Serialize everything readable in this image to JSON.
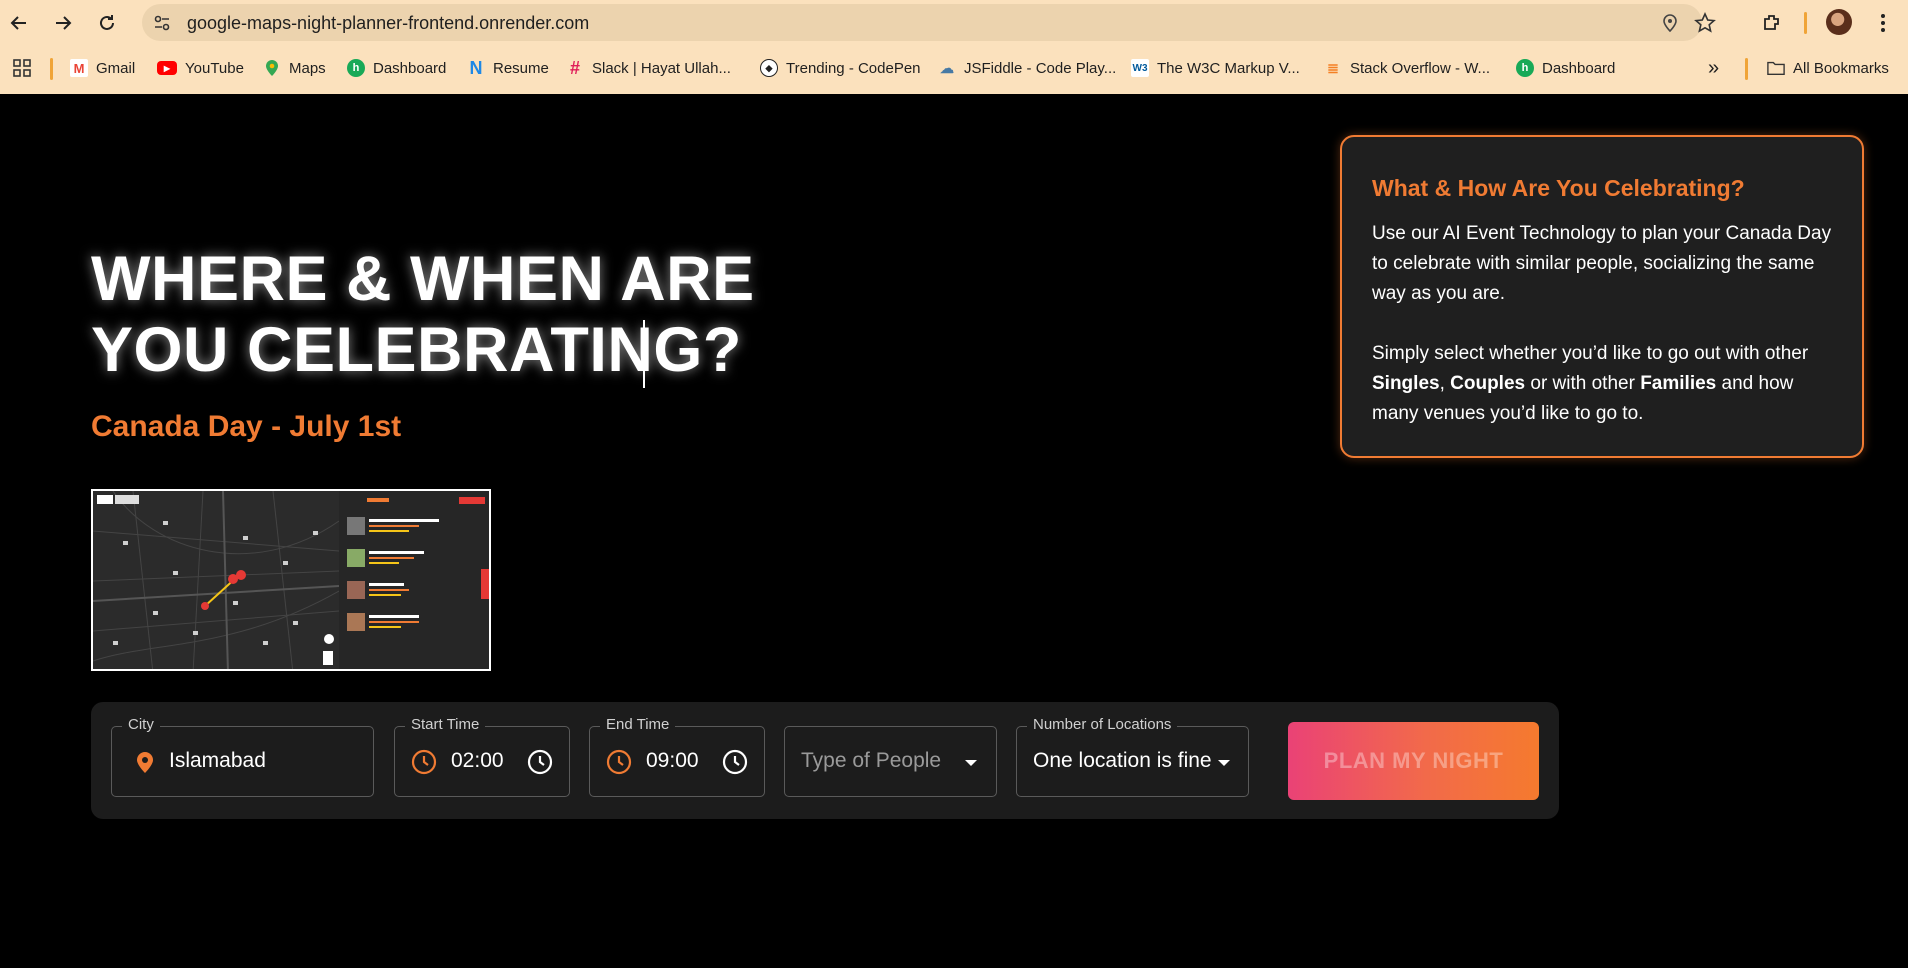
{
  "browser": {
    "url": "google-maps-night-planner-frontend.onrender.com",
    "bookmarks": [
      {
        "label": "Gmail",
        "icon": "gmail-icon"
      },
      {
        "label": "YouTube",
        "icon": "youtube-icon"
      },
      {
        "label": "Maps",
        "icon": "maps-icon"
      },
      {
        "label": "Dashboard",
        "icon": "dashboard-icon"
      },
      {
        "label": "Resume",
        "icon": "resume-icon"
      },
      {
        "label": "Slack | Hayat Ullah...",
        "icon": "slack-icon"
      },
      {
        "label": "Trending - CodePen",
        "icon": "codepen-icon"
      },
      {
        "label": "JSFiddle - Code Play...",
        "icon": "jsfiddle-icon"
      },
      {
        "label": "The W3C Markup V...",
        "icon": "w3c-icon"
      },
      {
        "label": "Stack Overflow - W...",
        "icon": "stackoverflow-icon"
      },
      {
        "label": "Dashboard",
        "icon": "dashboard-icon"
      }
    ],
    "all_bookmarks": "All Bookmarks"
  },
  "hero": {
    "title_line1": "WHERE & WHEN ARE",
    "title_line2": "YOU CELEBRATING?",
    "subtitle": "Canada Day - July 1st"
  },
  "info": {
    "title": "What & How Are You Celebrating?",
    "p1": "Use our AI Event Technology to plan your Canada Day to celebrate with similar people, socializing the same way as you are.",
    "p2_a": "Simply select whether you’d like to go out with other ",
    "singles": "Singles",
    "comma": ", ",
    "couples": "Couples",
    "p2_b": " or with other ",
    "families": "Families",
    "p2_c": " and how many venues you’d like to go to."
  },
  "form": {
    "city_label": "City",
    "city_value": "Islamabad",
    "start_label": "Start Time",
    "start_value": "02:00",
    "end_label": "End Time",
    "end_value": "09:00",
    "people_placeholder": "Type of People",
    "locations_label": "Number of Locations",
    "locations_value": "One location is fine",
    "plan_button": "PLAN MY NIGHT"
  },
  "colors": {
    "accent": "#f07b33",
    "button_start": "#ea4276",
    "button_end": "#f57a2e"
  }
}
